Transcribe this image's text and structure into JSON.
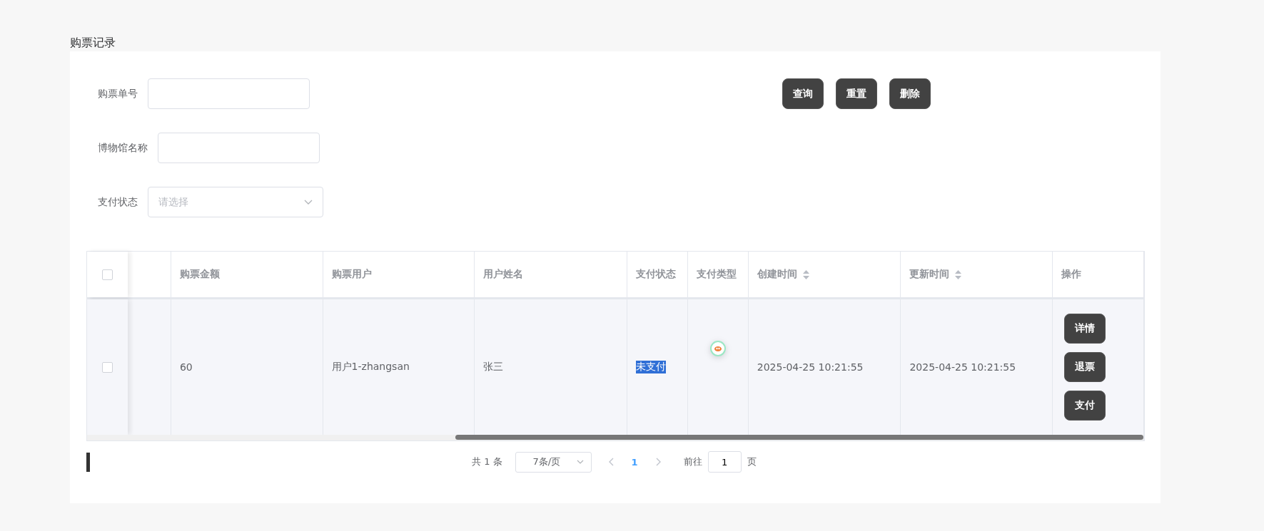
{
  "page_title": "购票记录",
  "filters": [
    {
      "kind": "input",
      "label": "购票单号"
    },
    {
      "kind": "input",
      "label": "博物馆名称"
    },
    {
      "kind": "select",
      "label": "支付状态",
      "placeholder": "请选择"
    }
  ],
  "buttons": [
    "查询",
    "重置",
    "删除"
  ],
  "table": {
    "select_all_checked": false,
    "columns": [
      {
        "label": "购票金额",
        "sortable": false
      },
      {
        "label": "购票用户",
        "sortable": false
      },
      {
        "label": "用户姓名",
        "sortable": false
      },
      {
        "label": "支付状态",
        "sortable": false
      },
      {
        "label": "支付类型",
        "sortable": false
      },
      {
        "label": "创建时间",
        "sortable": true
      },
      {
        "label": "更新时间",
        "sortable": true
      },
      {
        "label": "操作",
        "sortable": false
      }
    ],
    "rows": [
      {
        "checked": false,
        "amount": "60",
        "user": "用户1-zhangsan",
        "name": "张三",
        "status": "未支付",
        "status_highlighted": true,
        "created": "2025-04-25 10:21:55",
        "updated": "2025-04-25 10:21:55",
        "actions": [
          "详情",
          "退票",
          "支付"
        ]
      }
    ]
  },
  "pagination": {
    "total": "共 1 条",
    "page_size": "7条/页",
    "pages": [
      {
        "label": "1",
        "selected": true
      }
    ],
    "goto_label": "前往",
    "goto_value": "1",
    "goto_suffix": "页"
  }
}
